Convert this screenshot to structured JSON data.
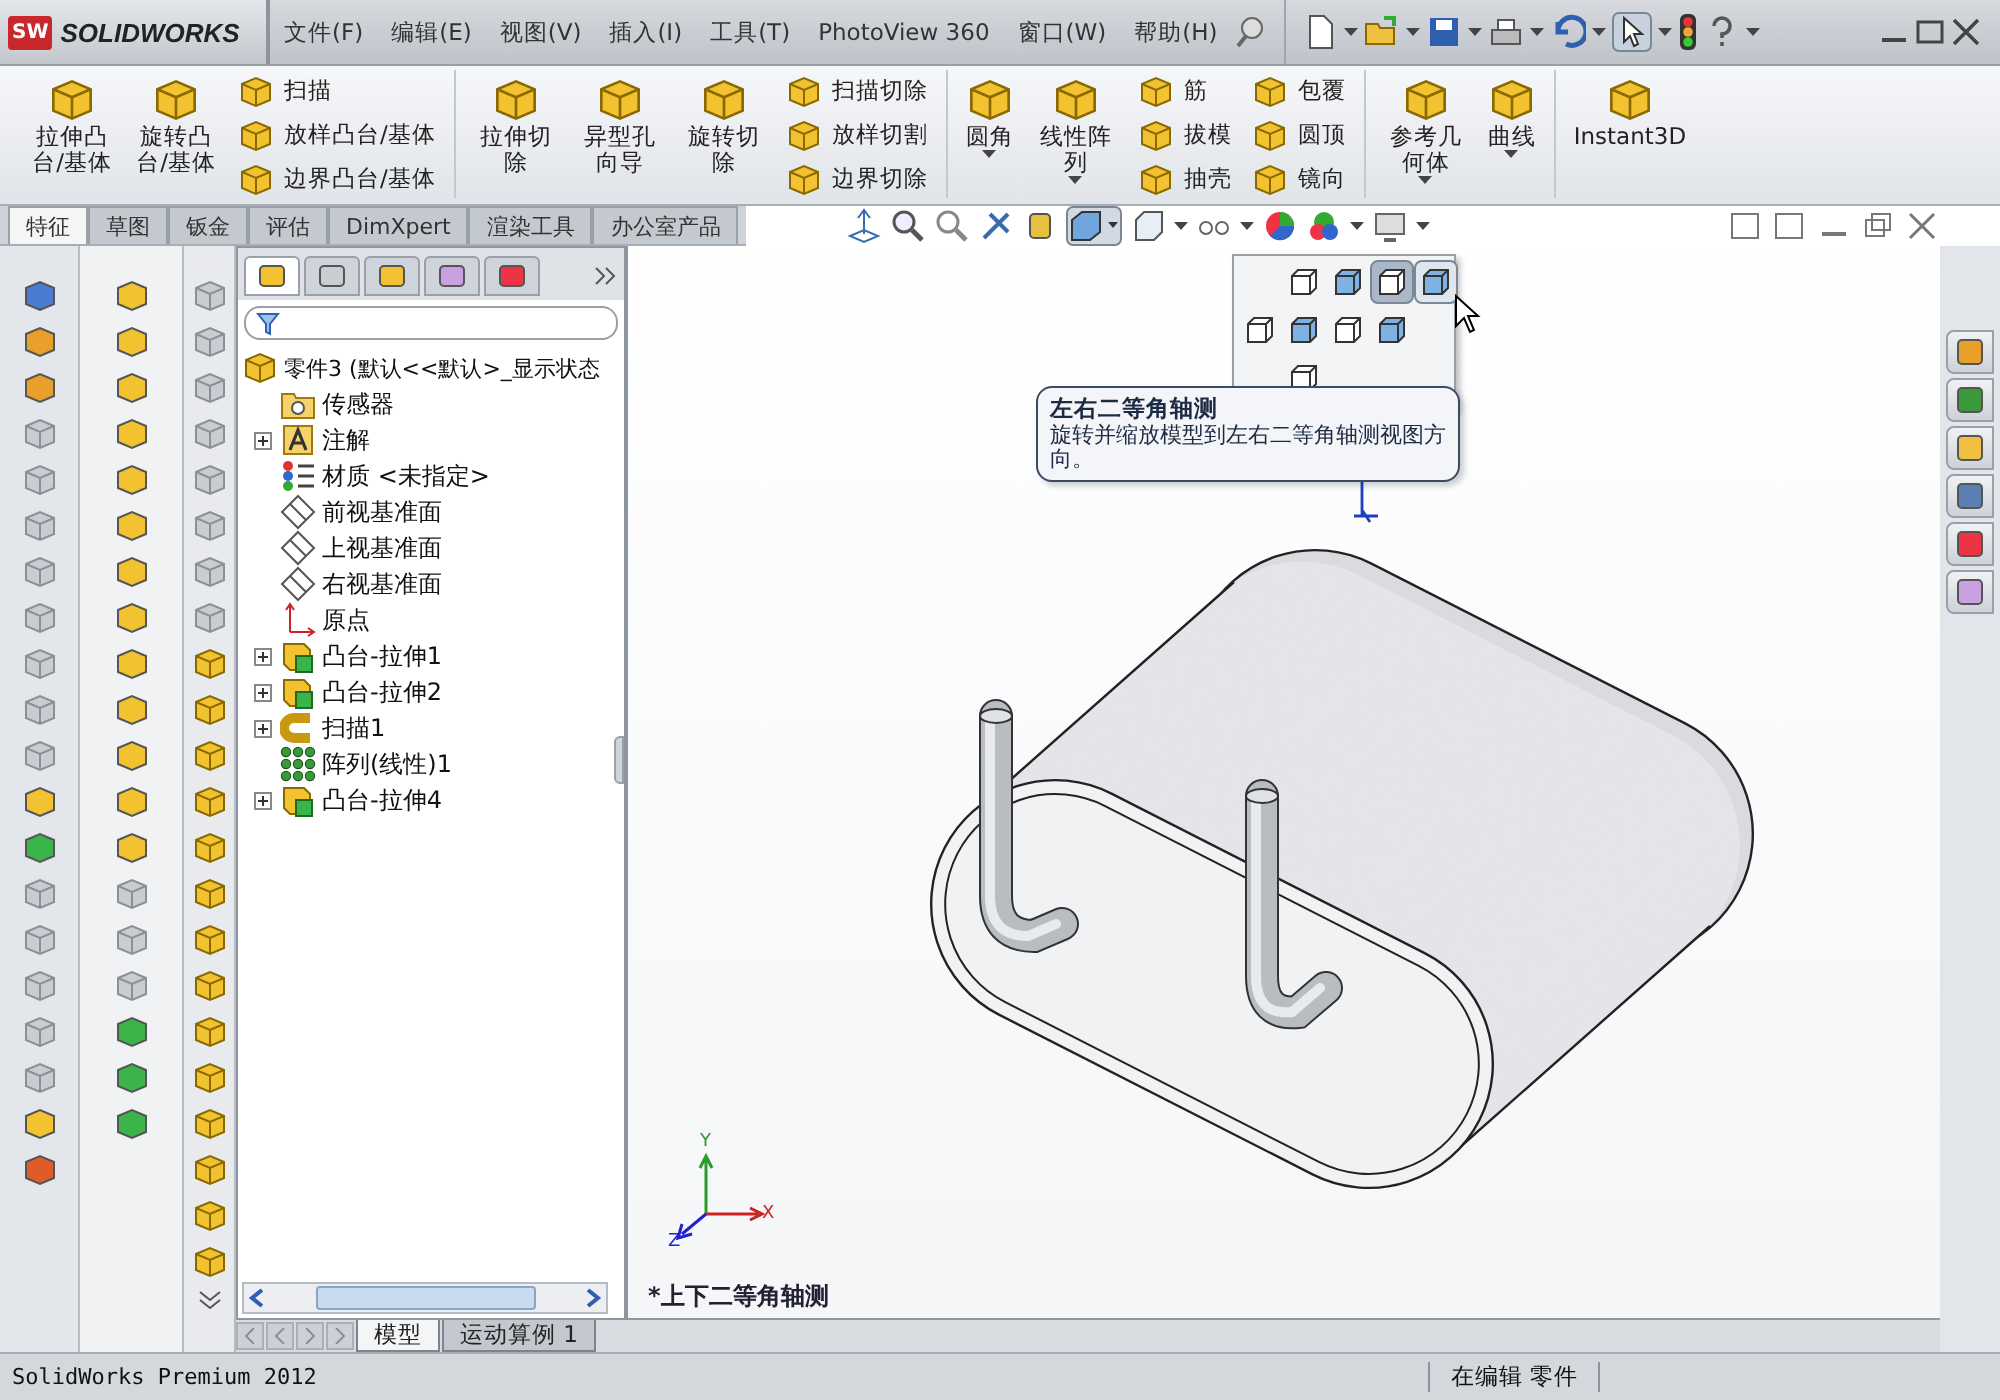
{
  "app": {
    "logo_badge": "SW",
    "logo_text": "SOLIDWORKS"
  },
  "menu": [
    "文件(F)",
    "编辑(E)",
    "视图(V)",
    "插入(I)",
    "工具(T)",
    "PhotoView 360",
    "窗口(W)",
    "帮助(H)"
  ],
  "ribbon": {
    "groups": [
      {
        "items": [
          {
            "kind": "big",
            "label": "拉伸凸台/基体",
            "dropdown": false
          },
          {
            "kind": "big",
            "label": "旋转凸台/基体",
            "dropdown": false
          },
          {
            "kind": "stack",
            "items": [
              {
                "label": "扫描"
              },
              {
                "label": "放样凸台/基体"
              },
              {
                "label": "边界凸台/基体"
              }
            ]
          }
        ]
      },
      {
        "items": [
          {
            "kind": "big",
            "label": "拉伸切除",
            "dropdown": false
          },
          {
            "kind": "big",
            "label": "异型孔向导",
            "dropdown": false
          },
          {
            "kind": "big",
            "label": "旋转切除",
            "dropdown": false
          },
          {
            "kind": "stack",
            "items": [
              {
                "label": "扫描切除"
              },
              {
                "label": "放样切割"
              },
              {
                "label": "边界切除"
              }
            ]
          }
        ]
      },
      {
        "items": [
          {
            "kind": "big",
            "label": "圆角",
            "dropdown": true
          },
          {
            "kind": "big",
            "label": "线性阵列",
            "dropdown": true
          },
          {
            "kind": "stack",
            "items": [
              {
                "label": "筋"
              },
              {
                "label": "拔模"
              },
              {
                "label": "抽壳"
              }
            ]
          },
          {
            "kind": "stack",
            "items": [
              {
                "label": "包覆"
              },
              {
                "label": "圆顶"
              },
              {
                "label": "镜向"
              }
            ]
          }
        ]
      },
      {
        "items": [
          {
            "kind": "big",
            "label": "参考几何体",
            "dropdown": true
          },
          {
            "kind": "big",
            "label": "曲线",
            "dropdown": true
          }
        ]
      },
      {
        "items": [
          {
            "kind": "wide",
            "label": "Instant3D",
            "dropdown": false
          }
        ]
      }
    ]
  },
  "command_tabs": [
    {
      "label": "特征",
      "selected": true
    },
    {
      "label": "草图",
      "selected": false
    },
    {
      "label": "钣金",
      "selected": false
    },
    {
      "label": "评估",
      "selected": false
    },
    {
      "label": "DimXpert",
      "selected": false
    },
    {
      "label": "渲染工具",
      "selected": false
    },
    {
      "label": "办公室产品",
      "selected": false
    }
  ],
  "tree_tabs": [
    {
      "selected": true
    },
    {
      "selected": false
    },
    {
      "selected": false
    },
    {
      "selected": false
    },
    {
      "selected": false
    }
  ],
  "tree": {
    "root": "零件3  (默认<<默认>_显示状态",
    "items": [
      {
        "kind": "folder",
        "label": "传感器",
        "collapsed": false
      },
      {
        "kind": "annotation",
        "label": "注解",
        "collapsed": true
      },
      {
        "kind": "material",
        "label": "材质 <未指定>",
        "collapsed": false
      },
      {
        "kind": "plane",
        "label": "前视基准面",
        "collapsed": false
      },
      {
        "kind": "plane",
        "label": "上视基准面",
        "collapsed": false
      },
      {
        "kind": "plane",
        "label": "右视基准面",
        "collapsed": false
      },
      {
        "kind": "origin",
        "label": "原点",
        "collapsed": false
      },
      {
        "kind": "feature",
        "label": "凸台-拉伸1",
        "collapsed": true
      },
      {
        "kind": "feature",
        "label": "凸台-拉伸2",
        "collapsed": true
      },
      {
        "kind": "sweep",
        "label": "扫描1",
        "collapsed": true
      },
      {
        "kind": "pattern",
        "label": "阵列(线性)1",
        "collapsed": false
      },
      {
        "kind": "feature",
        "label": "凸台-拉伸4",
        "collapsed": true
      }
    ]
  },
  "view_menu": {
    "options": [
      {
        "selected": false,
        "hovered": false
      },
      {
        "selected": false,
        "hovered": false
      },
      {
        "selected": true,
        "hovered": false
      },
      {
        "selected": false,
        "hovered": true
      },
      {
        "selected": false,
        "hovered": false
      },
      {
        "selected": false,
        "hovered": false
      },
      {
        "selected": false,
        "hovered": false
      },
      {
        "selected": false,
        "hovered": false
      },
      {
        "selected": false,
        "hovered": false
      }
    ]
  },
  "tooltip": {
    "title": "左右二等角轴测",
    "text": "旋转并缩放模型到左右二等角轴测视图方向。"
  },
  "viewport": {
    "view_label": "*上下二等角轴测",
    "axes": {
      "x": "X",
      "y": "Y",
      "z": "Z"
    }
  },
  "bottom_tabs": [
    {
      "label": "模型",
      "selected": true
    },
    {
      "label": "运动算例 1",
      "selected": false
    }
  ],
  "status_bar": {
    "product": "SolidWorks Premium 2012",
    "mode": "在编辑 零件"
  }
}
